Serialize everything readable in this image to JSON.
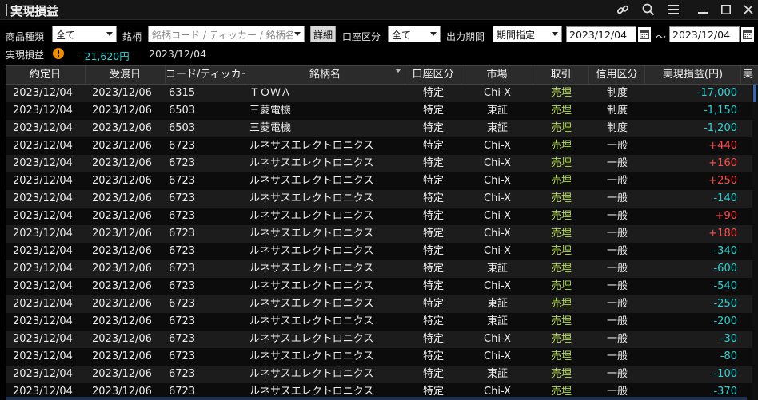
{
  "window": {
    "title": "実現損益"
  },
  "filters": {
    "product_label": "商品種類",
    "product_value": "全て",
    "symbol_label": "銘柄",
    "symbol_placeholder": "銘柄コード / ティッカー / 銘柄名",
    "detail_label": "詳細",
    "account_label": "口座区分",
    "account_value": "全て",
    "period_label": "出力期間",
    "period_value": "期間指定",
    "date_from": "2023/12/04",
    "tilde": "～",
    "date_to": "2023/12/04"
  },
  "summary": {
    "label": "実現損益",
    "warn_glyph": "!",
    "amount": "-21,620円",
    "date": "2023/12/04"
  },
  "colors": {
    "positive": "#ff4a4a",
    "negative": "#2ed3d3",
    "trade": "#b6d956"
  },
  "table": {
    "headers": [
      "約定日",
      "受渡日",
      "コード/ティッカー",
      "銘柄名",
      "口座区分",
      "市場",
      "取引",
      "信用区分",
      "実現損益(円)",
      "実"
    ],
    "rows": [
      [
        "2023/12/04",
        "2023/12/06",
        "6315",
        "ＴＯＷＡ",
        "特定",
        "Chi-X",
        "売埋",
        "制度",
        "-17,000"
      ],
      [
        "2023/12/04",
        "2023/12/06",
        "6503",
        "三菱電機",
        "特定",
        "東証",
        "売埋",
        "制度",
        "-1,150"
      ],
      [
        "2023/12/04",
        "2023/12/06",
        "6503",
        "三菱電機",
        "特定",
        "東証",
        "売埋",
        "制度",
        "-1,200"
      ],
      [
        "2023/12/04",
        "2023/12/06",
        "6723",
        "ルネサスエレクトロニクス",
        "特定",
        "Chi-X",
        "売埋",
        "一般",
        "+440"
      ],
      [
        "2023/12/04",
        "2023/12/06",
        "6723",
        "ルネサスエレクトロニクス",
        "特定",
        "Chi-X",
        "売埋",
        "一般",
        "+160"
      ],
      [
        "2023/12/04",
        "2023/12/06",
        "6723",
        "ルネサスエレクトロニクス",
        "特定",
        "Chi-X",
        "売埋",
        "一般",
        "+250"
      ],
      [
        "2023/12/04",
        "2023/12/06",
        "6723",
        "ルネサスエレクトロニクス",
        "特定",
        "Chi-X",
        "売埋",
        "一般",
        "-140"
      ],
      [
        "2023/12/04",
        "2023/12/06",
        "6723",
        "ルネサスエレクトロニクス",
        "特定",
        "Chi-X",
        "売埋",
        "一般",
        "+90"
      ],
      [
        "2023/12/04",
        "2023/12/06",
        "6723",
        "ルネサスエレクトロニクス",
        "特定",
        "Chi-X",
        "売埋",
        "一般",
        "+180"
      ],
      [
        "2023/12/04",
        "2023/12/06",
        "6723",
        "ルネサスエレクトロニクス",
        "特定",
        "Chi-X",
        "売埋",
        "一般",
        "-340"
      ],
      [
        "2023/12/04",
        "2023/12/06",
        "6723",
        "ルネサスエレクトロニクス",
        "特定",
        "東証",
        "売埋",
        "一般",
        "-600"
      ],
      [
        "2023/12/04",
        "2023/12/06",
        "6723",
        "ルネサスエレクトロニクス",
        "特定",
        "Chi-X",
        "売埋",
        "一般",
        "-540"
      ],
      [
        "2023/12/04",
        "2023/12/06",
        "6723",
        "ルネサスエレクトロニクス",
        "特定",
        "東証",
        "売埋",
        "一般",
        "-250"
      ],
      [
        "2023/12/04",
        "2023/12/06",
        "6723",
        "ルネサスエレクトロニクス",
        "特定",
        "東証",
        "売埋",
        "一般",
        "-200"
      ],
      [
        "2023/12/04",
        "2023/12/06",
        "6723",
        "ルネサスエレクトロニクス",
        "特定",
        "Chi-X",
        "売埋",
        "一般",
        "-30"
      ],
      [
        "2023/12/04",
        "2023/12/06",
        "6723",
        "ルネサスエレクトロニクス",
        "特定",
        "Chi-X",
        "売埋",
        "一般",
        "-80"
      ],
      [
        "2023/12/04",
        "2023/12/06",
        "6723",
        "ルネサスエレクトロニクス",
        "特定",
        "東証",
        "売埋",
        "一般",
        "-100"
      ],
      [
        "2023/12/04",
        "2023/12/06",
        "6723",
        "ルネサスエレクトロニクス",
        "特定",
        "Chi-X",
        "売埋",
        "一般",
        "-370"
      ]
    ]
  }
}
